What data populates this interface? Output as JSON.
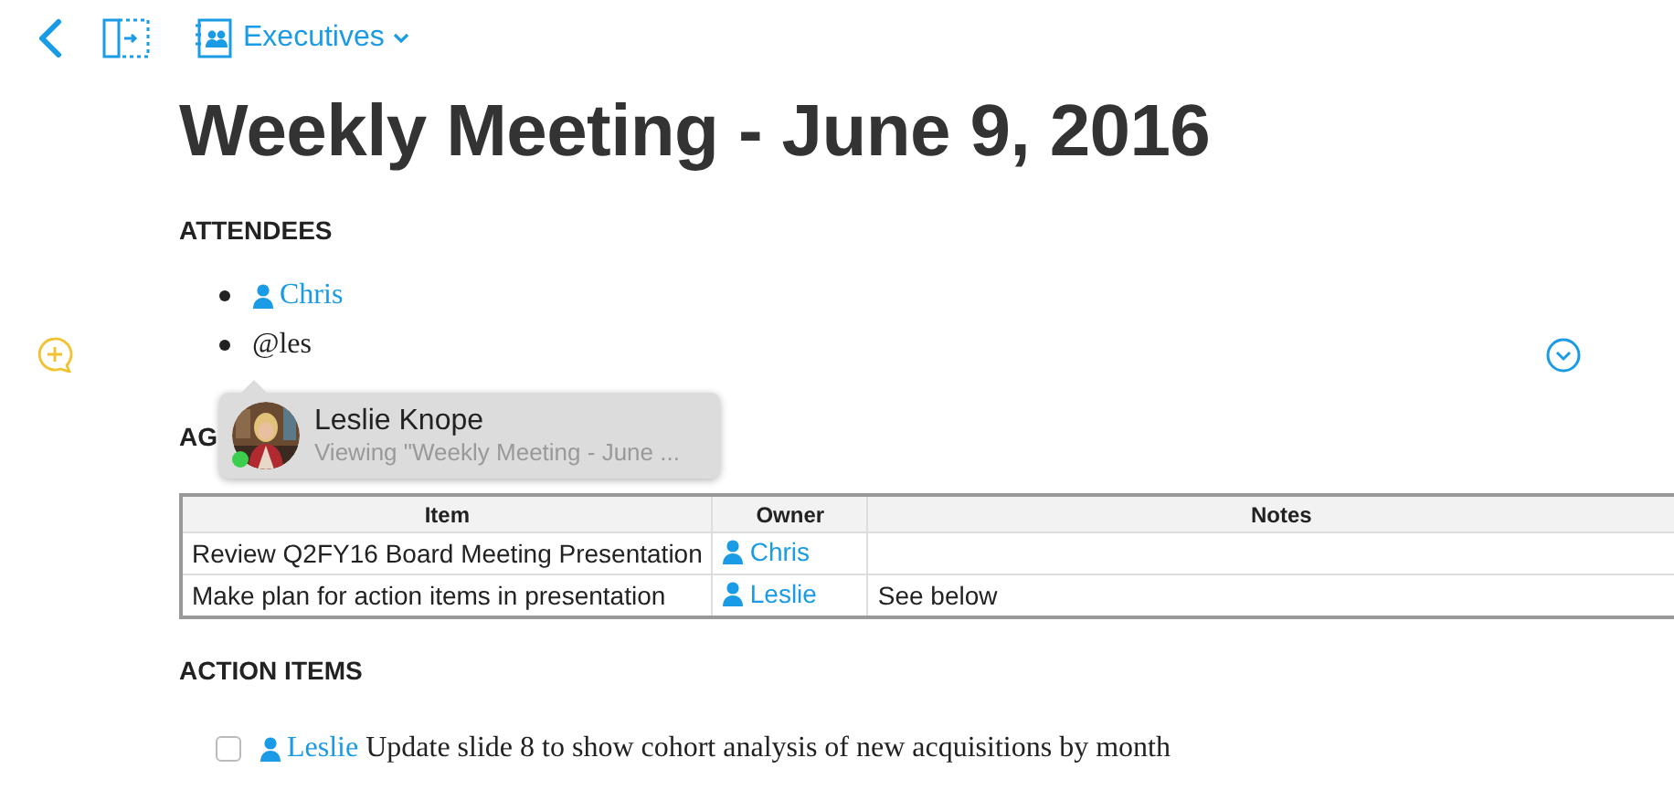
{
  "toolbar": {
    "notebook": "Executives"
  },
  "title": "Weekly Meeting - June 9, 2016",
  "attendees": {
    "heading": "ATTENDEES",
    "items": [
      {
        "kind": "mention",
        "text": "Chris"
      },
      {
        "kind": "plain",
        "text": "@les"
      }
    ]
  },
  "mention_popup": {
    "name": "Leslie Knope",
    "status": "Viewing \"Weekly Meeting - June ...",
    "online": true
  },
  "agenda": {
    "heading": "AG",
    "table": {
      "columns": [
        "Item",
        "Owner",
        "Notes"
      ],
      "rows": [
        {
          "item": "Review Q2FY16 Board Meeting Presentation",
          "owner": "Chris"
        },
        {
          "item": "Make plan for action items in presentation",
          "owner": "Leslie",
          "notes": "See below"
        }
      ]
    }
  },
  "action_items": {
    "heading": "ACTION ITEMS",
    "items": [
      {
        "checked": false,
        "owner": "Leslie",
        "text": "Update slide 8 to show cohort analysis of new acquisitions by month"
      }
    ]
  }
}
